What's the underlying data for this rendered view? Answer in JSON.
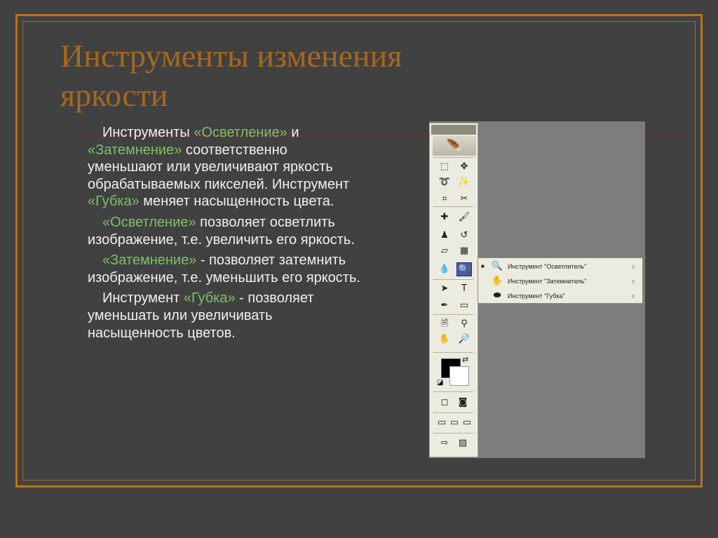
{
  "slide": {
    "title_line1": "Инструменты изменения",
    "title_line2": "яркости",
    "paragraphs": [
      {
        "before": "Инструменты ",
        "hl1": "«Осветление»",
        "mid": " и ",
        "hl2": "«Затемнение»",
        "after": " соответственно уменьшают или увеличивают яркость обрабатываемых пикселей. Инструмент ",
        "hl3": "«Губка»",
        "end": " меняет насыщенность цвета."
      },
      {
        "hl": "«Осветление»",
        "after": " позволяет осветлить изображение, т.е. увеличить его яркость."
      },
      {
        "hl": "«Затемнение»",
        "after": " - позволяет затемнить изображение, т.е. уменьшить его яркость."
      },
      {
        "before": "Инструмент ",
        "hl": "«Губка»",
        "after": " - позволяет уменьшать или увеличивать насыщенность цветов."
      }
    ]
  },
  "toolbox": {
    "logo_icon": "feather-icon",
    "tools": [
      {
        "name": "marquee",
        "glyph": "⬚"
      },
      {
        "name": "move",
        "glyph": "✥"
      },
      {
        "name": "lasso",
        "glyph": "➰"
      },
      {
        "name": "magic-wand",
        "glyph": "✨"
      },
      {
        "name": "crop",
        "glyph": "⌗"
      },
      {
        "name": "slice",
        "glyph": "✂"
      },
      {
        "name": "healing-brush",
        "glyph": "✚"
      },
      {
        "name": "brush",
        "glyph": "🖌"
      },
      {
        "name": "clone-stamp",
        "glyph": "♟"
      },
      {
        "name": "history-brush",
        "glyph": "↺"
      },
      {
        "name": "eraser",
        "glyph": "▱"
      },
      {
        "name": "gradient",
        "glyph": "▦"
      },
      {
        "name": "blur",
        "glyph": "💧"
      },
      {
        "name": "dodge",
        "glyph": "🔍"
      },
      {
        "name": "path-selection",
        "glyph": "➤"
      },
      {
        "name": "type",
        "glyph": "T"
      },
      {
        "name": "pen",
        "glyph": "✒"
      },
      {
        "name": "shape",
        "glyph": "▭"
      },
      {
        "name": "notes",
        "glyph": "🗎"
      },
      {
        "name": "eyedropper",
        "glyph": "⚲"
      },
      {
        "name": "hand",
        "glyph": "✋"
      },
      {
        "name": "zoom",
        "glyph": "🔎"
      }
    ],
    "flyout": [
      {
        "icon": "dodge-icon",
        "glyph": "🔍",
        "label": "Инструмент \"Осветлитель\"",
        "selected": true
      },
      {
        "icon": "burn-icon",
        "glyph": "✋",
        "label": "Инструмент \"Затемнитель\"",
        "selected": false
      },
      {
        "icon": "sponge-icon",
        "glyph": "⬬",
        "label": "Инструмент \"Губка\"",
        "selected": false
      }
    ],
    "key_symbol": "○",
    "selected_mark": "■",
    "colors": {
      "foreground": "#000000",
      "background": "#ffffff",
      "selection": "#4e5ba5"
    }
  }
}
